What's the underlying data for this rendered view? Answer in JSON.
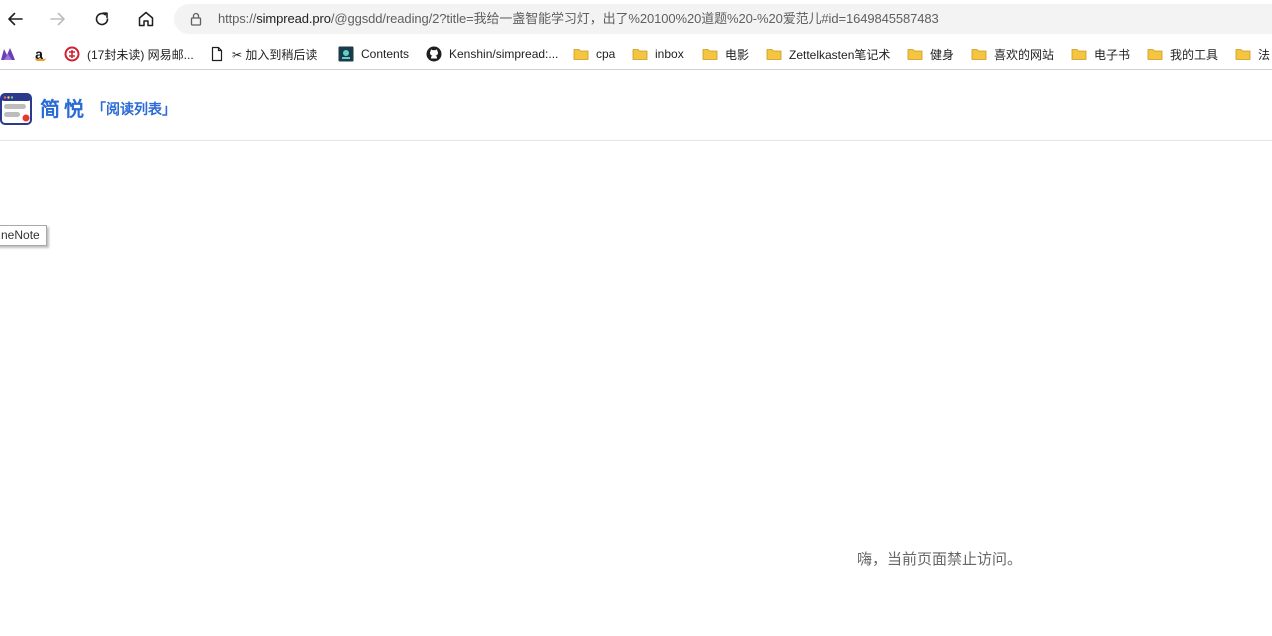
{
  "browser": {
    "address": {
      "scheme": "https://",
      "host": "simpread.pro",
      "path": "/@ggsdd/reading/2?title=我给一盏智能学习灯，出了%20100%20道题%20-%20爱范儿#id=1649845587483"
    }
  },
  "bookmarks": [
    {
      "label": "",
      "icon": "purple-app-icon"
    },
    {
      "label": "",
      "icon": "amazon-icon"
    },
    {
      "label": "(17封未读) 网易邮...",
      "icon": "netease-mail-icon"
    },
    {
      "label": "✂ 加入到稍后读",
      "icon": "page-icon"
    },
    {
      "label": "Contents",
      "icon": "contents-icon"
    },
    {
      "label": "Kenshin/simpread:...",
      "icon": "github-icon"
    },
    {
      "label": "cpa",
      "icon": "folder-icon"
    },
    {
      "label": "inbox",
      "icon": "folder-icon"
    },
    {
      "label": "电影",
      "icon": "folder-icon"
    },
    {
      "label": "Zettelkasten笔记术",
      "icon": "folder-icon"
    },
    {
      "label": "健身",
      "icon": "folder-icon"
    },
    {
      "label": "喜欢的网站",
      "icon": "folder-icon"
    },
    {
      "label": "电子书",
      "icon": "folder-icon"
    },
    {
      "label": "我的工具",
      "icon": "folder-icon"
    },
    {
      "label": "法",
      "icon": "folder-icon"
    }
  ],
  "header": {
    "app_name": "简悦",
    "subtitle": "「阅读列表」"
  },
  "onenote_chip": "neNote",
  "message": "嗨，当前页面禁止访问。",
  "colors": {
    "accent": "#2b6bd6",
    "folder": "#f5c542",
    "message": "#666666"
  }
}
